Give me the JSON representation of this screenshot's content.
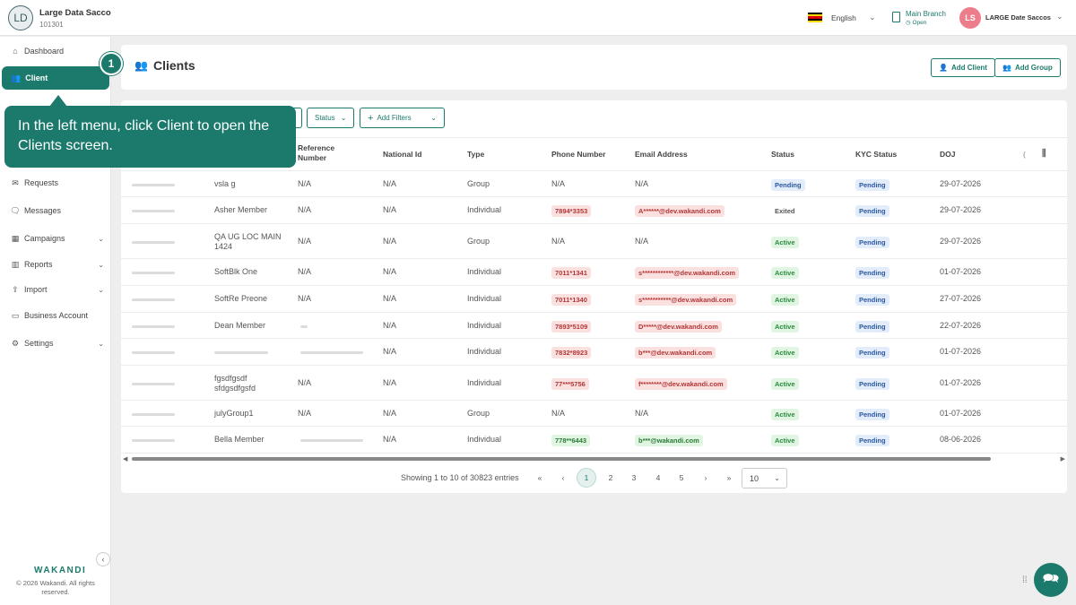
{
  "org": {
    "initials": "LD",
    "name": "Large Data Sacco",
    "code": "101301"
  },
  "topbar": {
    "language": "English",
    "branch_name": "Main Branch",
    "branch_status": "Open",
    "user_initials": "LS",
    "user_name": "LARGE Date Saccos"
  },
  "sidebar": {
    "items": [
      {
        "label": "Dashboard",
        "icon": "home-icon"
      },
      {
        "label": "Client",
        "icon": "users-icon"
      },
      {
        "label": "Requests",
        "icon": "mail-icon"
      },
      {
        "label": "Messages",
        "icon": "chat-icon"
      },
      {
        "label": "Campaigns",
        "icon": "grid-icon"
      },
      {
        "label": "Reports",
        "icon": "chart-icon"
      },
      {
        "label": "Import",
        "icon": "upload-icon"
      },
      {
        "label": "Business Account",
        "icon": "briefcase-icon"
      },
      {
        "label": "Settings",
        "icon": "gear-icon"
      }
    ],
    "brand": "WAKANDI",
    "copyright": "© 2026 Wakandi. All rights reserved."
  },
  "tooltip": {
    "step": "1",
    "text": "In the left menu, click Client to open the Clients screen."
  },
  "header": {
    "title": "Clients",
    "add_client": "Add Client",
    "add_group": "Add Group"
  },
  "filters": {
    "status": "Status",
    "add_filters": "Add Filters"
  },
  "table": {
    "columns": {
      "ref_line1": "Reference",
      "ref_line2": "Number",
      "national_id": "National Id",
      "type": "Type",
      "phone": "Phone Number",
      "email": "Email Address",
      "status": "Status",
      "kyc": "KYC Status",
      "doj": "DOJ"
    },
    "rows": [
      {
        "name": "vsla g",
        "ref": "N/A",
        "nid": "N/A",
        "type": "Group",
        "phone": "N/A",
        "email": "N/A",
        "status": "Pending",
        "kyc": "Pending",
        "doj": "29-07-2026"
      },
      {
        "name": "Asher Member",
        "ref": "N/A",
        "nid": "N/A",
        "type": "Individual",
        "phone": "7894*3353",
        "email": "A******@dev.wakandi.com",
        "status": "Exited",
        "kyc": "Pending",
        "doj": "29-07-2026"
      },
      {
        "name": "QA UG LOC MAIN 1424",
        "ref": "N/A",
        "nid": "N/A",
        "type": "Group",
        "phone": "N/A",
        "email": "N/A",
        "status": "Active",
        "kyc": "Pending",
        "doj": "29-07-2026"
      },
      {
        "name": "SoftBlk One",
        "ref": "N/A",
        "nid": "N/A",
        "type": "Individual",
        "phone": "7011*1341",
        "email": "s************@dev.wakandi.com",
        "status": "Active",
        "kyc": "Pending",
        "doj": "01-07-2026"
      },
      {
        "name": "SoftRe Preone",
        "ref": "N/A",
        "nid": "N/A",
        "type": "Individual",
        "phone": "7011*1340",
        "email": "s***********@dev.wakandi.com",
        "status": "Active",
        "kyc": "Pending",
        "doj": "27-07-2026"
      },
      {
        "name": "Dean Member",
        "ref": "",
        "nid": "N/A",
        "type": "Individual",
        "phone": "7893*5109",
        "email": "D*****@dev.wakandi.com",
        "status": "Active",
        "kyc": "Pending",
        "doj": "22-07-2026"
      },
      {
        "name": "",
        "ref": "",
        "nid": "N/A",
        "type": "Individual",
        "phone": "7832*8923",
        "email": "b***@dev.wakandi.com",
        "status": "Active",
        "kyc": "Pending",
        "doj": "01-07-2026"
      },
      {
        "name": "fgsdfgsdf sfdgsdfgsfd",
        "ref": "N/A",
        "nid": "N/A",
        "type": "Individual",
        "phone": "77***5756",
        "email": "f********@dev.wakandi.com",
        "status": "Active",
        "kyc": "Pending",
        "doj": "01-07-2026"
      },
      {
        "name": "julyGroup1",
        "ref": "N/A",
        "nid": "N/A",
        "type": "Group",
        "phone": "N/A",
        "email": "N/A",
        "status": "Active",
        "kyc": "Pending",
        "doj": "01-07-2026"
      },
      {
        "name": "Bella Member",
        "ref": "",
        "nid": "N/A",
        "type": "Individual",
        "phone": "778**6443",
        "email": "b***@wakandi.com",
        "status": "Active",
        "kyc": "Pending",
        "doj": "08-06-2026"
      }
    ]
  },
  "pagination": {
    "showing": "Showing 1 to 10 of 30823 entries",
    "pages": [
      "1",
      "2",
      "3",
      "4",
      "5"
    ],
    "page_size": "10"
  },
  "colors": {
    "accent": "#1c7a6c",
    "pending": "#2b58a0",
    "active": "#2a8a3e",
    "masked": "#b23636"
  }
}
